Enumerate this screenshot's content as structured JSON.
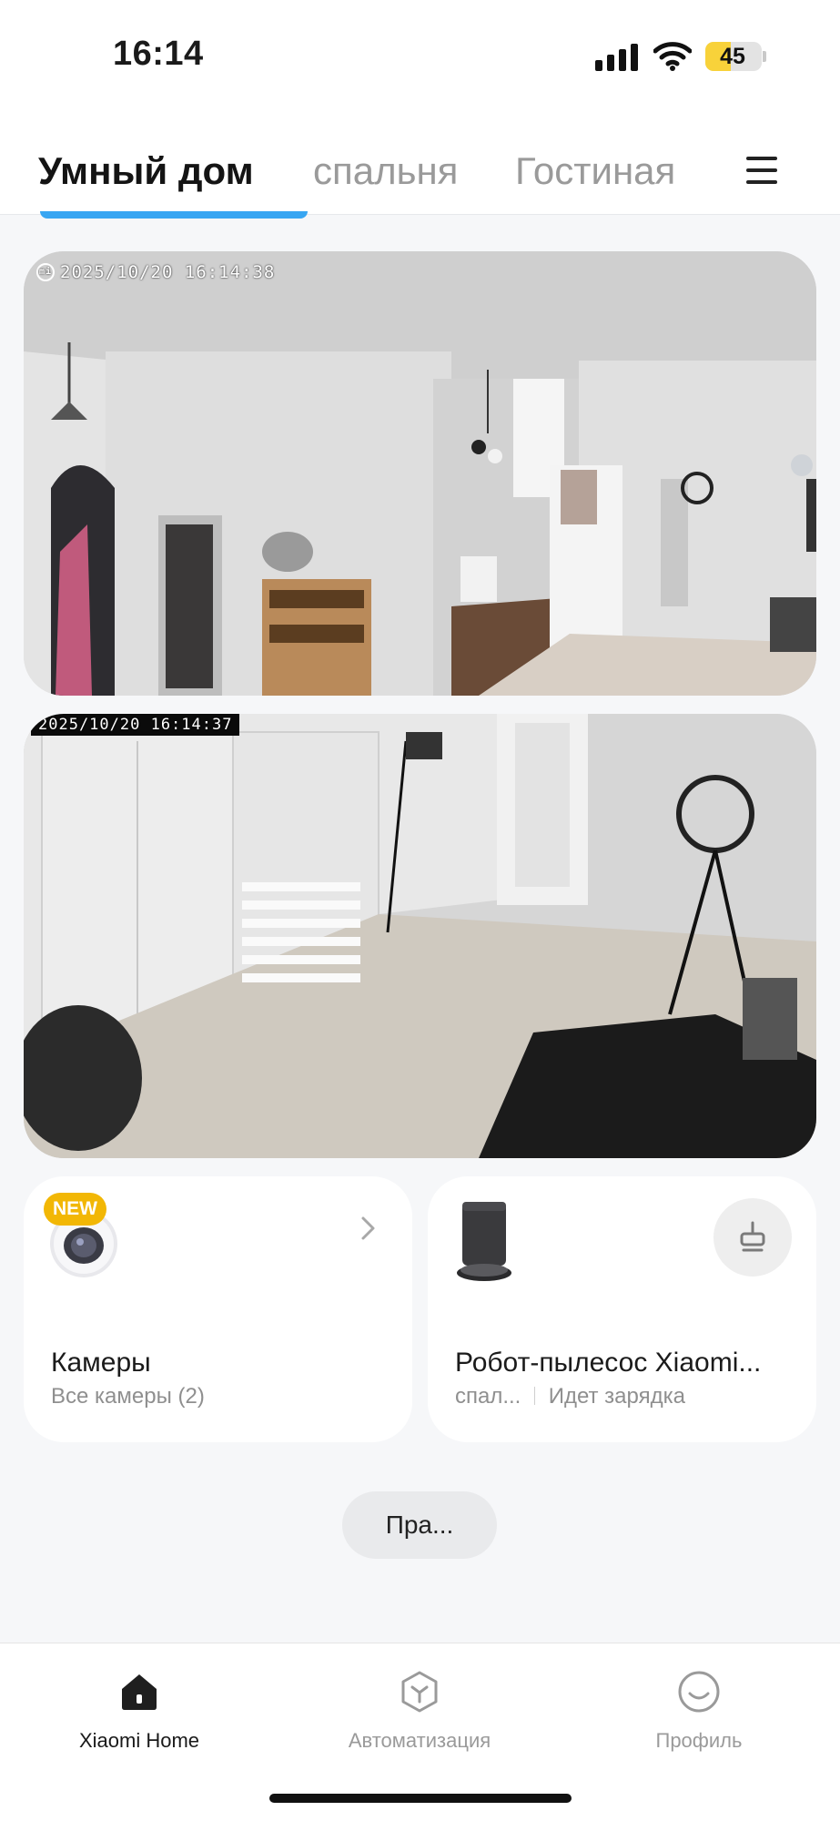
{
  "status_bar": {
    "time": "16:14",
    "battery_level": "45",
    "battery_fraction": 0.45
  },
  "tabs": [
    {
      "label": "Умный дом",
      "active": true
    },
    {
      "label": "спальня",
      "active": false
    },
    {
      "label": "Гостиная",
      "active": false
    }
  ],
  "cameras": [
    {
      "timestamp": "2025/10/20  16:14:38",
      "badge": "mi"
    },
    {
      "timestamp": "2025/10/20 16:14:37"
    }
  ],
  "cards": {
    "cameras": {
      "badge": "NEW",
      "title": "Камеры",
      "subtitle": "Все камеры (2)"
    },
    "vacuum": {
      "title": "Робот-пылесос Xiaomi...",
      "room": "спал...",
      "status": "Идет зарядка"
    }
  },
  "pill_button": {
    "label": "Пра..."
  },
  "bottom_nav": [
    {
      "label": "Xiaomi Home",
      "icon": "home-icon",
      "active": true
    },
    {
      "label": "Автоматизация",
      "icon": "automation-icon",
      "active": false
    },
    {
      "label": "Профиль",
      "icon": "profile-icon",
      "active": false
    }
  ],
  "colors": {
    "accent": "#38a6f2",
    "new_badge": "#f2b705",
    "battery": "#f8d23a"
  }
}
